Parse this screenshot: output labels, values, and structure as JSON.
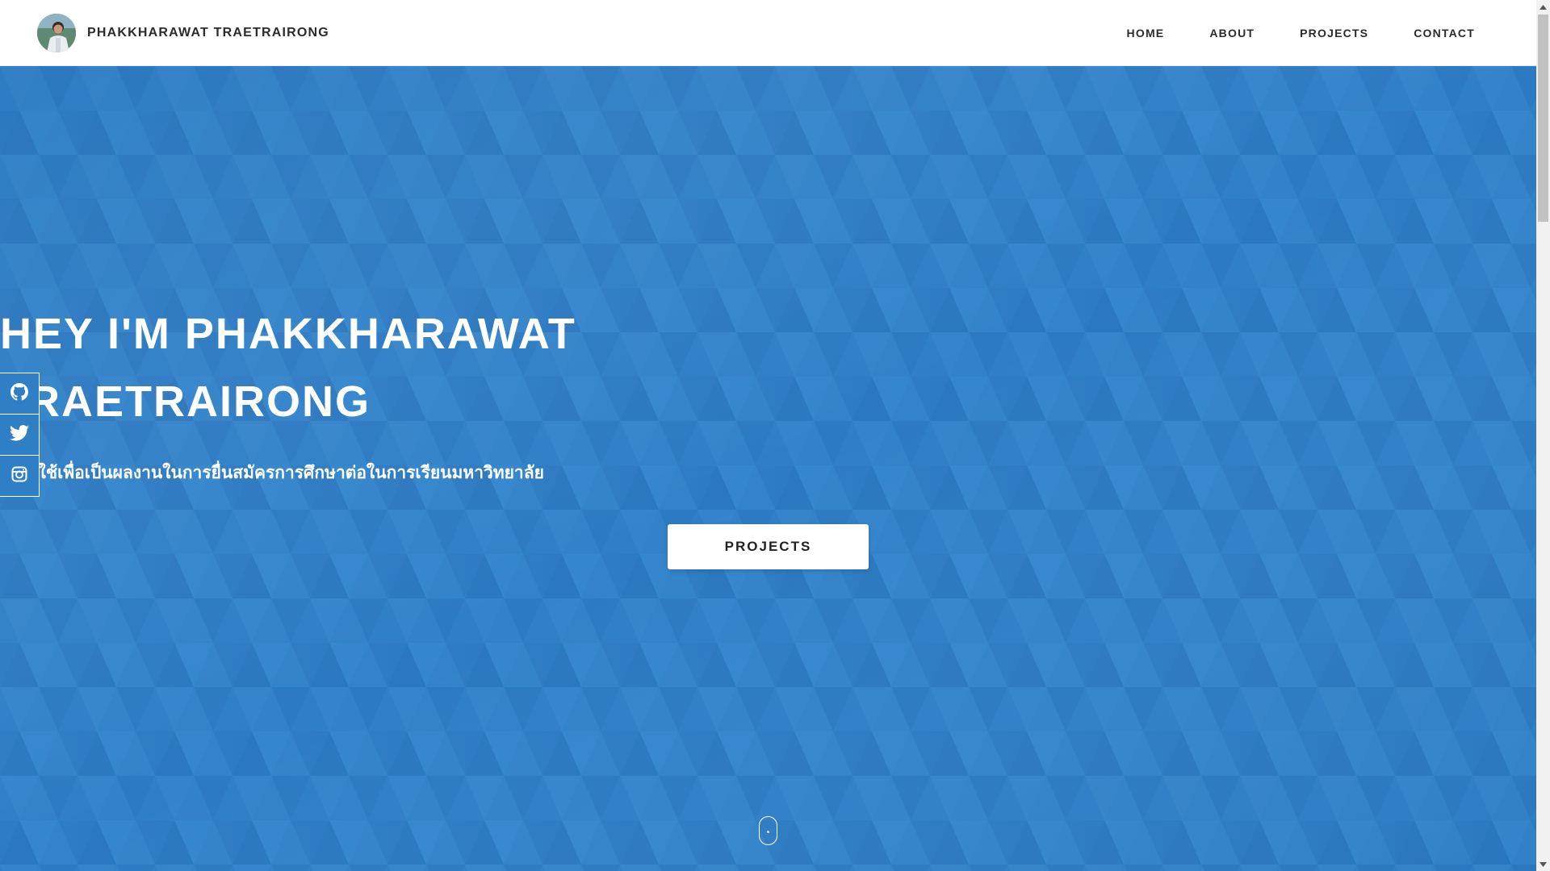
{
  "brand": {
    "name": "PHAKKHARAWAT TRAETRAIRONG",
    "avatar_icon": "avatar-photo"
  },
  "nav": {
    "items": [
      {
        "label": "HOME"
      },
      {
        "label": "ABOUT"
      },
      {
        "label": "PROJECTS"
      },
      {
        "label": "CONTACT"
      }
    ]
  },
  "hero": {
    "title_line1": "HEY I'M PHAKKHARAWAT",
    "title_line2": "TRAETRAIRONG",
    "subtitle": "เว็บนี้ใช้เพื่อเป็นผลงานในการยื่นสมัครการศึกษาต่อในการเรียนมหาวิทยาลัย",
    "cta_label": "PROJECTS"
  },
  "social": {
    "items": [
      {
        "icon": "github-icon"
      },
      {
        "icon": "twitter-icon"
      },
      {
        "icon": "instagram-icon"
      }
    ]
  },
  "colors": {
    "hero_bg": "#2f7fc7",
    "header_bg": "#ffffff",
    "nav_text": "#2b2b2b"
  }
}
